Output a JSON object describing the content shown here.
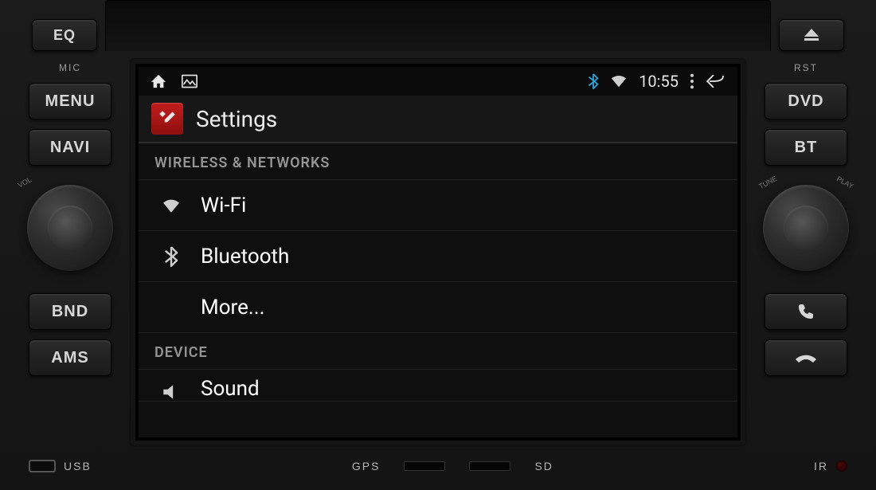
{
  "hw": {
    "eq": "EQ",
    "mic": "MIC",
    "menu": "MENU",
    "navi": "NAVI",
    "bnd": "BND",
    "ams": "AMS",
    "rst": "RST",
    "dvd": "DVD",
    "bt": "BT",
    "vol_label": "VOL",
    "tune_label_l": "TUNE",
    "tune_label_r": "PLAY"
  },
  "ports": {
    "usb": "USB",
    "gps": "GPS",
    "sd": "SD",
    "ir": "IR"
  },
  "statusbar": {
    "time": "10:55"
  },
  "settings": {
    "title": "Settings",
    "section_wireless": "WIRELESS & NETWORKS",
    "wifi": "Wi-Fi",
    "bluetooth": "Bluetooth",
    "more": "More...",
    "section_device": "DEVICE",
    "sound": "Sound"
  }
}
